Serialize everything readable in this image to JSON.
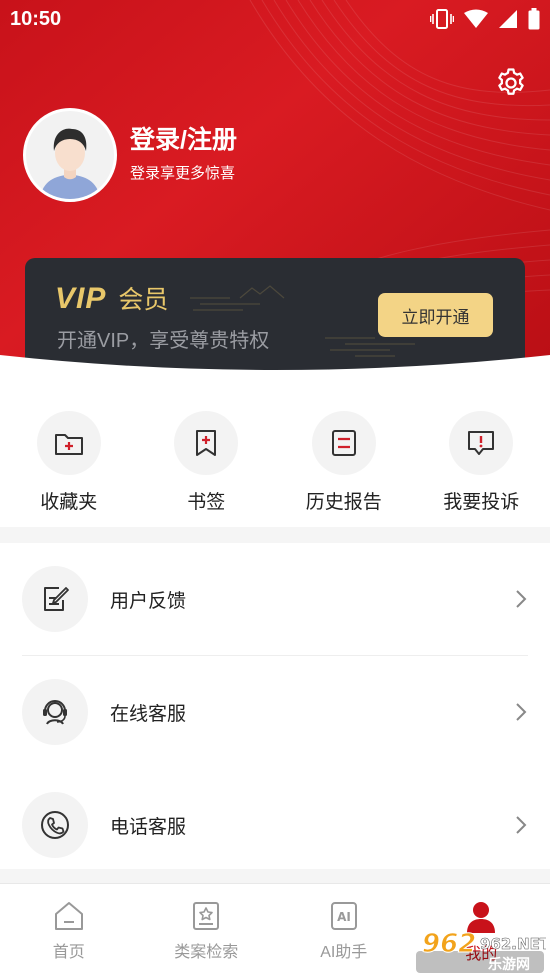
{
  "status_bar": {
    "time": "10:50"
  },
  "profile": {
    "title": "登录/注册",
    "subtitle": "登录享更多惊喜"
  },
  "vip": {
    "badge": "VIP",
    "label": "会员",
    "subtitle": "开通VIP，享受尊贵特权",
    "button": "立即开通"
  },
  "quick_actions": [
    {
      "label": "收藏夹",
      "icon": "folder-plus-icon"
    },
    {
      "label": "书签",
      "icon": "bookmark-plus-icon"
    },
    {
      "label": "历史报告",
      "icon": "history-report-icon"
    },
    {
      "label": "我要投诉",
      "icon": "complaint-icon"
    }
  ],
  "menu": [
    {
      "label": "用户反馈",
      "icon": "feedback-edit-icon"
    },
    {
      "label": "在线客服",
      "icon": "customer-service-icon"
    },
    {
      "label": "电话客服",
      "icon": "phone-icon"
    }
  ],
  "bottom_nav": [
    {
      "label": "首页",
      "icon": "home-icon"
    },
    {
      "label": "类案检索",
      "icon": "case-search-icon"
    },
    {
      "label": "AI助手",
      "icon": "ai-assistant-icon"
    },
    {
      "label": "我的",
      "icon": "profile-icon"
    }
  ],
  "watermark": {
    "text": "962.NET",
    "sub": "乐游网"
  },
  "colors": {
    "brand_red": "#c8121a",
    "vip_gold": "#e8c76a",
    "vip_button": "#f3d486",
    "vip_card": "#2a2d33"
  }
}
